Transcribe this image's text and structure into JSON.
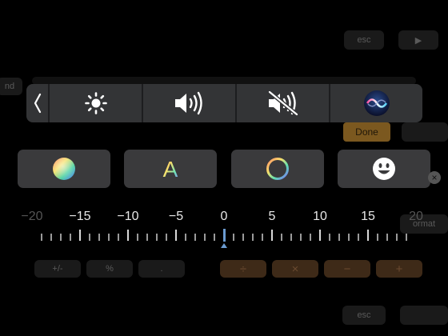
{
  "background": {
    "top_right_keys": [
      "esc",
      "▶"
    ],
    "left_fragment": "nd",
    "done_label": "Done",
    "format_label": "ormat",
    "calc_keys": [
      "+/-",
      "%",
      "."
    ],
    "operator_keys": [
      "÷",
      "×",
      "−",
      "+"
    ],
    "bottom_esc": "esc"
  },
  "control_strip": {
    "back_icon": "chevron-left-icon",
    "items": [
      {
        "name": "brightness",
        "icon": "sun-icon"
      },
      {
        "name": "volume",
        "icon": "speaker-volume-icon"
      },
      {
        "name": "mute",
        "icon": "speaker-muted-icon"
      },
      {
        "name": "siri",
        "icon": "siri-icon"
      }
    ]
  },
  "buttons": [
    {
      "name": "color-picker",
      "icon": "color-wheel-icon"
    },
    {
      "name": "text-style",
      "icon": "letter-a-icon",
      "label": "A"
    },
    {
      "name": "stroke",
      "icon": "ring-icon"
    },
    {
      "name": "emoji",
      "icon": "emoji-smile-icon"
    }
  ],
  "slider": {
    "labels": [
      "-20",
      "-15",
      "-10",
      "-5",
      "0",
      "5",
      "10",
      "15",
      "20"
    ],
    "min": -20,
    "max": 20,
    "value": 0,
    "minor_step": 1,
    "major_step": 5,
    "accent": "#6b9bd1"
  },
  "colors": {
    "strip": "#333436",
    "button": "#3a3a3c",
    "done": "#e0a13a",
    "operator": "#3e2a18"
  }
}
